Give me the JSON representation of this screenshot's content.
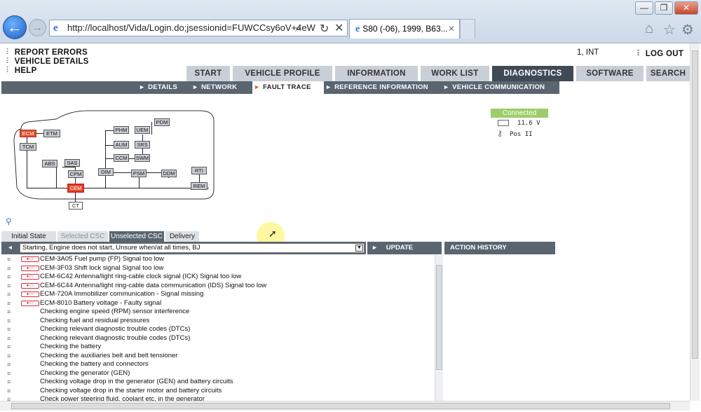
{
  "browser": {
    "address": "http://localhost/Vida/Login.do;jsessionid=FUWCCsy6oV+4eW",
    "tab_title": "S80 (-06), 1999, B63...",
    "window_buttons": [
      "—",
      "❐",
      "✕"
    ]
  },
  "side_links": [
    "REPORT ERRORS",
    "VEHICLE DETAILS",
    "HELP"
  ],
  "user": {
    "name": "1, INT",
    "logout": "LOG OUT"
  },
  "main_tabs": [
    "START",
    "VEHICLE PROFILE",
    "INFORMATION",
    "WORK LIST",
    "DIAGNOSTICS",
    "SOFTWARE",
    "SEARCH"
  ],
  "sub_tabs": [
    "DETAILS",
    "NETWORK",
    "FAULT TRACE",
    "REFERENCE INFORMATION",
    "VEHICLE COMMUNICATION"
  ],
  "modules": [
    "ECM",
    "ETM",
    "TCM",
    "PHM",
    "UEM",
    "PDM",
    "AUM",
    "SRS",
    "CCM",
    "SWM",
    "ABS",
    "SAS",
    "CPM",
    "CEM",
    "CT",
    "DIM",
    "PSM",
    "DDM",
    "RTI",
    "REM"
  ],
  "status": {
    "connection": "Connected",
    "voltage": "11.6 V",
    "key": "Pos II"
  },
  "panel_tabs": [
    "Initial State",
    "Selected CSC",
    "Unselected CSC",
    "Delivery"
  ],
  "symptom": "Starting, Engine does not start, Unsure when/at all times, BJ",
  "update_label": "UPDATE",
  "action_history_label": "ACTION HISTORY",
  "fault_items": [
    "CEM-3A05 Fuel pump (FP) Signal too low",
    "CEM-3F03 Shift lock signal Signal too low",
    "CEM-6C42 Antenna/light ring-cable clock signal (ICK) Signal too low",
    "CEM-6C44 Antenna/light ring-cable data communication (IDS) Signal too low",
    "ECM-720A Immobilizer communication - Signal missing",
    "ECM-8010 Battery voltage - Faulty signal"
  ],
  "check_items": [
    "Checking engine speed (RPM) sensor interference",
    "Checking fuel and residual pressures",
    "Checking relevant diagnostic trouble codes (DTCs)",
    "Checking relevant diagnostic trouble codes (DTCs)",
    "Checking the battery",
    "Checking the auxiliaries belt and belt tensioner",
    "Checking the battery and connectors",
    "Checking the generator (GEN)",
    "Checking voltage drop in the generator (GEN) and battery circuits",
    "Checking voltage drop in the starter motor and battery circuits",
    "Check power steering fluid, coolant etc. in the generator"
  ],
  "icons": [
    "back-icon",
    "forward-icon",
    "ie-logo-icon",
    "search-icon",
    "refresh-icon",
    "stop-icon",
    "home-icon",
    "favorites-icon",
    "tools-icon",
    "battery-icon",
    "key-icon",
    "pin-icon",
    "cursor-highlight"
  ]
}
